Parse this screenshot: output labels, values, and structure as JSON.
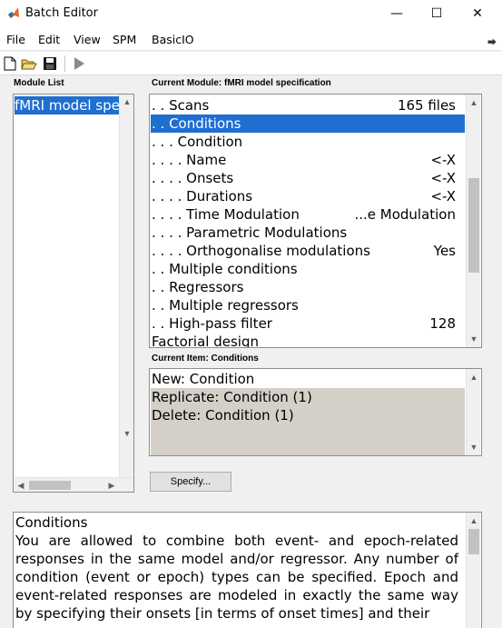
{
  "window": {
    "title": "Batch Editor",
    "minimize_glyph": "—",
    "maximize_glyph": "☐",
    "close_glyph": "✕"
  },
  "menu": {
    "items": [
      "File",
      "Edit",
      "View",
      "SPM",
      "BasicIO"
    ],
    "overflow_glyph": "⮕"
  },
  "toolbar": {
    "icons": [
      "new-file-icon",
      "open-folder-icon",
      "save-icon",
      "run-icon"
    ]
  },
  "module_list": {
    "label": "Module List",
    "items": [
      {
        "label": "fMRI model specification",
        "selected": true
      }
    ]
  },
  "current_module": {
    "label": "Current Module: fMRI model specification",
    "rows": [
      {
        "label": ". . Scans",
        "value": "165 files",
        "selected": false
      },
      {
        "label": ". . Conditions",
        "value": "",
        "selected": true
      },
      {
        "label": ". . . Condition",
        "value": "",
        "selected": false
      },
      {
        "label": ". . . . Name",
        "value": "<-X",
        "selected": false
      },
      {
        "label": ". . . . Onsets",
        "value": "<-X",
        "selected": false
      },
      {
        "label": ". . . . Durations",
        "value": "<-X",
        "selected": false
      },
      {
        "label": ". . . . Time Modulation",
        "value": "...e Modulation",
        "selected": false
      },
      {
        "label": ". . . . Parametric Modulations",
        "value": "",
        "selected": false
      },
      {
        "label": ". . . . Orthogonalise modulations",
        "value": "Yes",
        "selected": false
      },
      {
        "label": ". . Multiple conditions",
        "value": "",
        "selected": false
      },
      {
        "label": ". . Regressors",
        "value": "",
        "selected": false
      },
      {
        "label": ". . Multiple regressors",
        "value": "",
        "selected": false
      },
      {
        "label": ". . High-pass filter",
        "value": "128",
        "selected": false
      },
      {
        "label": "Factorial design",
        "value": "",
        "selected": false
      }
    ]
  },
  "current_item": {
    "label": "Current Item: Conditions",
    "rows": [
      {
        "label": "New: Condition",
        "highlight": false
      },
      {
        "label": "Replicate: Condition (1)",
        "highlight": true
      },
      {
        "label": "Delete: Condition (1)",
        "highlight": true
      }
    ]
  },
  "specify_button": "Specify...",
  "help": {
    "title": "Conditions",
    "body": "You are allowed to combine both event- and epoch-related responses in the same model and/or regressor. Any number of condition (event or epoch) types can be specified. Epoch and event-related responses are modeled in exactly the same way by specifying their onsets [in terms of onset times] and their"
  },
  "colors": {
    "selection": "#1f6fd0",
    "item_highlight": "#d4d0c8",
    "window_bg": "#f0f0f0"
  }
}
